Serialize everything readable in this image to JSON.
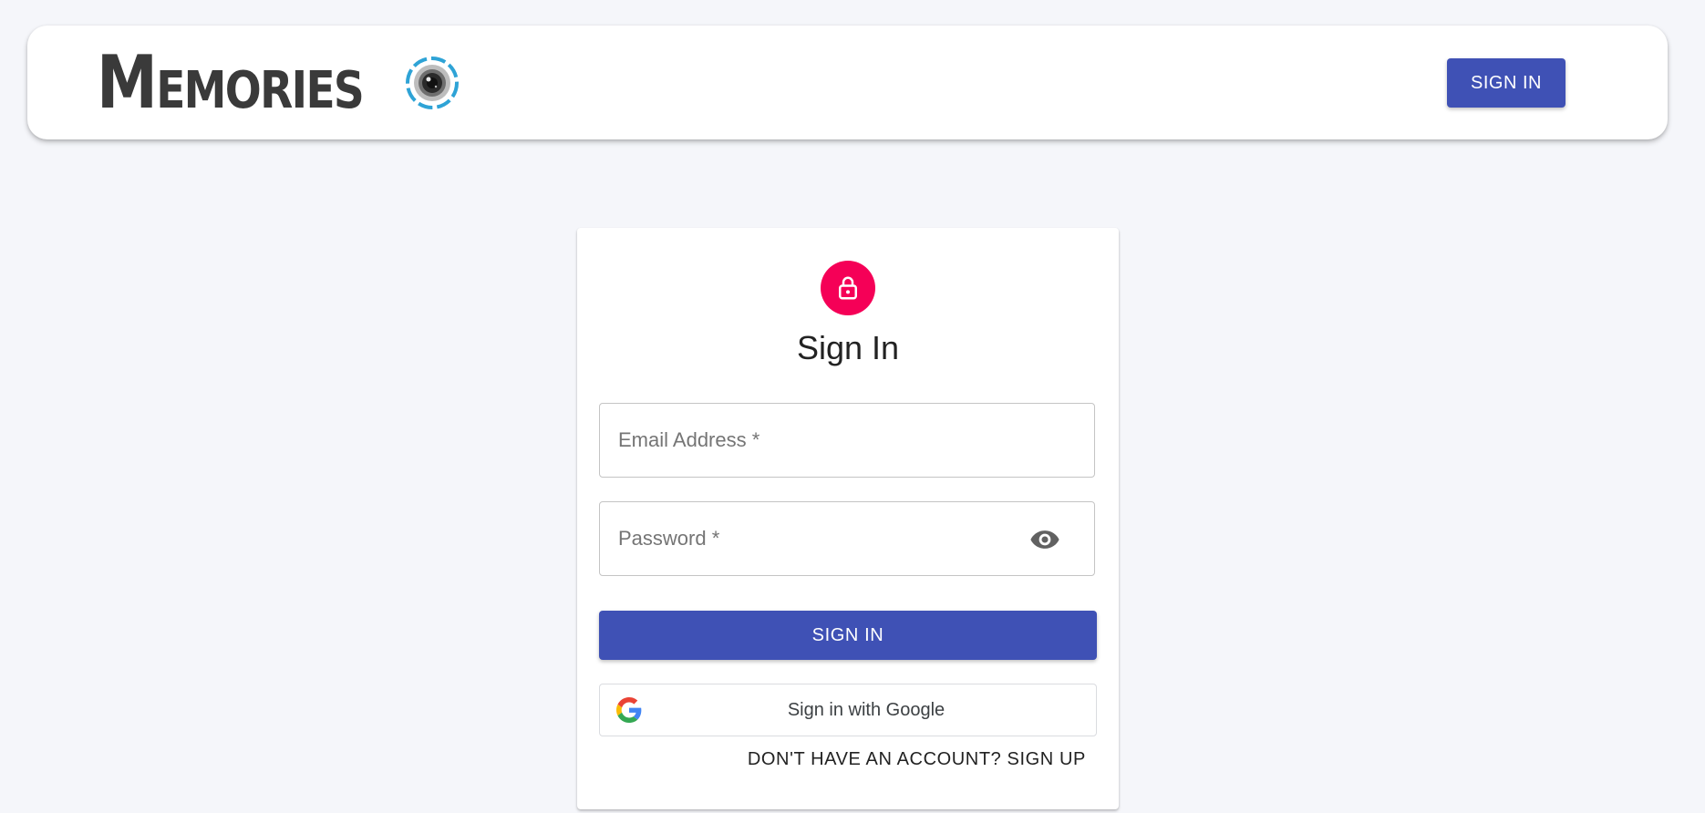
{
  "header": {
    "brand_text": "Memories",
    "logo_icon": "camera-lens-logo",
    "signin_label": "SIGN IN"
  },
  "colors": {
    "primary": "#3f51b5",
    "secondary": "#f50057",
    "background": "#f5f6fa"
  },
  "auth": {
    "avatar_icon": "lock-icon",
    "title": "Sign In",
    "email_placeholder": "Email Address *",
    "email_value": "",
    "password_placeholder": "Password *",
    "password_value": "",
    "visibility_icon": "eye-icon",
    "submit_label": "SIGN IN",
    "google_label": "Sign in with Google",
    "switch_label": "DON'T HAVE AN ACCOUNT? SIGN UP"
  }
}
